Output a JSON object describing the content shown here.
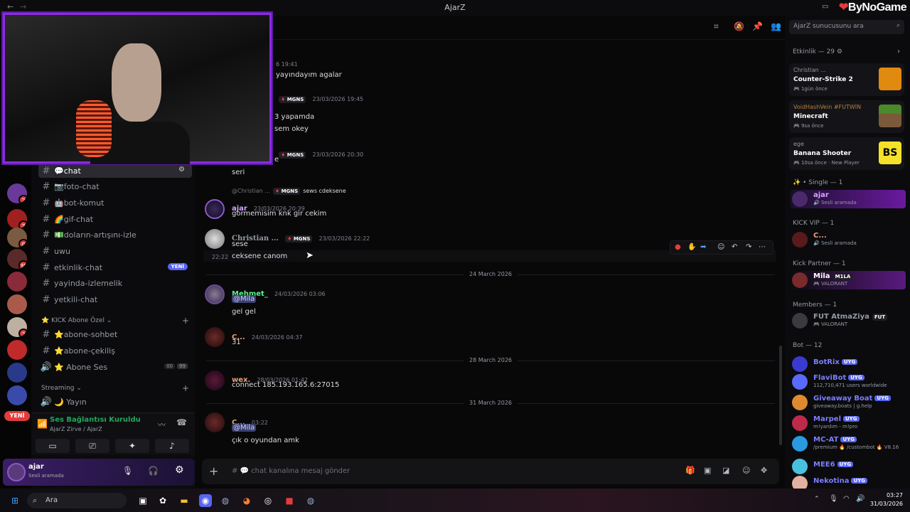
{
  "window": {
    "title": "AjarZ",
    "watermark": "ByNoGame"
  },
  "channels": [
    {
      "name": "💬chat",
      "active": true
    },
    {
      "name": "📷foto-chat"
    },
    {
      "name": "🤖bot-komut"
    },
    {
      "name": "🌈gif-chat"
    },
    {
      "name": "💵doların-artışını-izle"
    },
    {
      "name": "uwu"
    },
    {
      "name": "etkinlik-chat",
      "badge": "YENİ"
    },
    {
      "name": "yayinda-izlemelik"
    },
    {
      "name": "yetkili-chat"
    }
  ],
  "cat_kick": "KICK Abone Özel",
  "kick_channels": [
    "⭐abone-sohbet",
    "⭐abone-çekiliş",
    "⭐ Abone Ses"
  ],
  "abone_ses_counts": [
    "00",
    "99"
  ],
  "cat_streaming": "Streaming",
  "yayin": "🌙 Yayın",
  "server_new": "YENİ",
  "server_badges": [
    "2",
    "3",
    "9",
    "39",
    "2"
  ],
  "voice": {
    "status": "Ses Bağlantısı Kuruldu",
    "channel": "AjarZ Zirve / AjarZ"
  },
  "user": {
    "name": "ajar",
    "status": "Sesli aramada"
  },
  "messages": {
    "m0_time": "6 19:41",
    "m0_text": "yayındayım agalar",
    "m1_tag": "MGNS",
    "m1_time": "23/03/2026 19:45",
    "m1_text1": "3 yapamda",
    "m1_text2": "sem okey",
    "m2_tag": "MGNS",
    "m2_time": "23/03/2026 20:30",
    "m2_text0": "e",
    "m2_text": "seri",
    "reply_user": "@Christian ...",
    "reply_tag": "MGNS",
    "reply_text": "sews cdeksene",
    "m3_name": "ajar",
    "m3_time": "23/03/2026 20:39",
    "m3_text": "gormemisim knk gir cekim",
    "m4_name": "Christian ...",
    "m4_tag": "MGNS",
    "m4_time": "23/03/2026 22:22",
    "m4_text": "sese",
    "m4b_time": "22:22",
    "m4b_text": "ceksene canom",
    "div1": "24 March 2026",
    "m5_name": "Mehmet_",
    "m5_time": "24/03/2026 03:06",
    "m5_mention": "@Mila",
    "m5_text": "gel gel",
    "m6_name": "C...",
    "m6_time": "24/03/2026 04:37",
    "m6_text": "31",
    "div2": "28 March 2026",
    "m7_name": "wex.",
    "m7_time": "28/03/2026 01:42",
    "m7_text": "connect 185.193.165.6:27015",
    "div3": "31 March 2026",
    "m8_name": "C...",
    "m8_time": "03:22",
    "m8_mention": "@Mila",
    "m8_text": "çık o oyundan amk"
  },
  "composer": {
    "placeholder": "# 💬 chat kanalına mesaj gönder"
  },
  "search": {
    "placeholder": "AjarZ sunucusunu ara"
  },
  "activity": {
    "header": "Etkinlik — 29 ⚙",
    "cards": [
      {
        "user": "Christian ...",
        "game": "Counter-Strike 2",
        "time": "1gün önce"
      },
      {
        "user": "VoidHashVein #FUTWİN",
        "game": "Minecraft",
        "time": "9sa önce"
      },
      {
        "user": "ege",
        "game": "Banana Shooter",
        "time": "10sa önce",
        "extra": "New Player"
      }
    ]
  },
  "member_groups": {
    "single": "✨ • Single — 1",
    "kickvip": "KICK VIP — 1",
    "kickpartner": "Kick Partner — 1",
    "members": "Members — 1",
    "bot": "Bot — 12"
  },
  "members": [
    {
      "name": "ajar",
      "status": "Sesli aramada",
      "color": "#d9a3ff"
    },
    {
      "name": "C...",
      "status": "Sesli aramada",
      "color": "#e8a07a"
    },
    {
      "name": "Mila",
      "tag": "M1LA",
      "status": "VALORANT",
      "color": "#ffffff"
    },
    {
      "name": "FUT AtmaZiya",
      "tag": "FUT",
      "status": "VALORANT",
      "color": "#949ba4"
    },
    {
      "name": "BotRix",
      "status": "",
      "color": "#7d7dff"
    },
    {
      "name": "FlaviBot",
      "status": "112,710,471 users worldwide",
      "color": "#7d7dff"
    },
    {
      "name": "Giveaway Boat",
      "status": "giveaway.boats | g.help",
      "color": "#7d7dff"
    },
    {
      "name": "Marpel",
      "status": "m!yardım - m!pro",
      "color": "#7d7dff"
    },
    {
      "name": "MC-AT",
      "status": "/premium 🔥 /custombot 🔥 V8.16",
      "color": "#7d7dff"
    },
    {
      "name": "MEE6",
      "status": "",
      "color": "#7d7dff"
    },
    {
      "name": "Nekotina",
      "status": "",
      "color": "#7d7dff"
    }
  ],
  "uyg": "UYG",
  "taskbar": {
    "search": "Ara",
    "time": "03:27",
    "date": "31/03/2026"
  }
}
